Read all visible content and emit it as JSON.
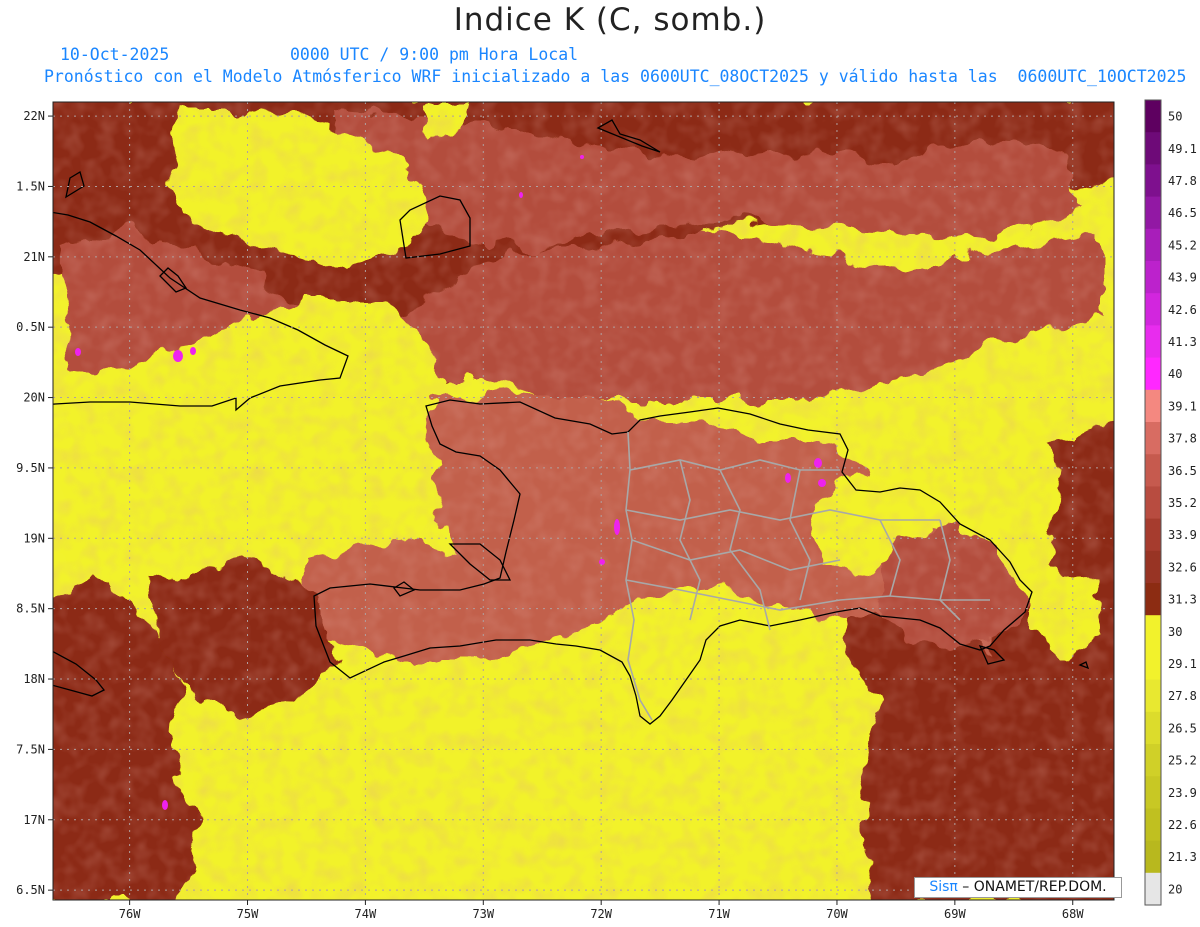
{
  "title": "Indice K (C, somb.)",
  "subtitle": {
    "date": "10-Oct-2025",
    "time": "0000 UTC / 9:00 pm Hora Local",
    "description": "Pronóstico con el Modelo Atmósferico WRF inicializado a las 0600UTC_08OCT2025 y válido hasta las  0600UTC_10OCT2025"
  },
  "map": {
    "variable": "K index",
    "region": "Hispaniola / Caribbean",
    "lon_range": [
      -76.65,
      -67.65
    ],
    "lat_range": [
      16.43,
      22.1
    ],
    "lon_ticks": [
      "76W",
      "75W",
      "74W",
      "73W",
      "72W",
      "71W",
      "70W",
      "69W",
      "68W"
    ],
    "lat_ticks": [
      "22N",
      "1.5N",
      "21N",
      "0.5N",
      "20N",
      "9.5N",
      "19N",
      "8.5N",
      "18N",
      "7.5N",
      "17N",
      "6.5N"
    ],
    "grid": true,
    "colors": {
      "ocean_yellow": "#f2f22c",
      "warm_brown": "#8c2c12",
      "mid_red": "#b34e3e",
      "land_pink": "#c2604c",
      "magenta": "#ee22ee",
      "coastline": "#000000",
      "borders": "#a8a8a8"
    }
  },
  "colorbar": {
    "labels": [
      "50",
      "49.1",
      "47.8",
      "46.5",
      "45.2",
      "43.9",
      "42.6",
      "41.3",
      "40",
      "39.1",
      "37.8",
      "36.5",
      "35.2",
      "33.9",
      "32.6",
      "31.3",
      "30",
      "29.1",
      "27.8",
      "26.5",
      "25.2",
      "23.9",
      "22.6",
      "21.3",
      "20"
    ],
    "colors": [
      "#5e0060",
      "#6e0a78",
      "#7e108e",
      "#9218a4",
      "#a81eba",
      "#bc22cc",
      "#d226de",
      "#e82cee",
      "#ff28ff",
      "#f48880",
      "#d86c62",
      "#c65a4e",
      "#b84c40",
      "#a63c2e",
      "#983424",
      "#8c2c12",
      "#f2f22c",
      "#f2f22c",
      "#e8e830",
      "#dcdc2c",
      "#d0d028",
      "#c8c824",
      "#c0c020",
      "#b8b81e",
      "#e6e6e6"
    ]
  },
  "credit": {
    "logo": "Sisπ",
    "text": " – ONAMET/REP.DOM."
  }
}
